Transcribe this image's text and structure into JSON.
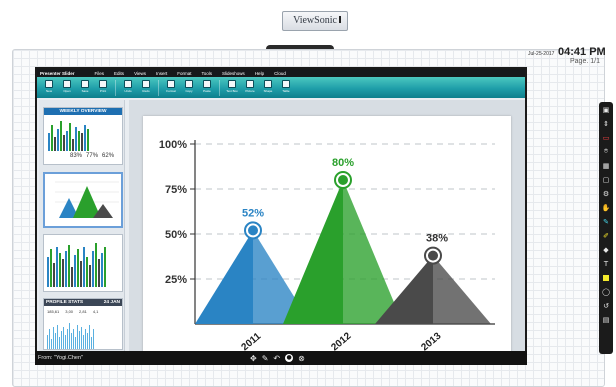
{
  "device": {
    "brand": "ViewSonic"
  },
  "status": {
    "date": "Jul-25-2017",
    "time": "04:41 PM",
    "page": "Page. 1/1"
  },
  "app": {
    "title": "Presenter Slider",
    "menu": [
      "Files",
      "Edits",
      "Views",
      "Insert",
      "Format",
      "Tools",
      "Slideshows",
      "Help",
      "Cloud"
    ],
    "ribbon_buttons": [
      {
        "label": "New",
        "icon": "new-file-icon"
      },
      {
        "label": "Open",
        "icon": "open-folder-icon"
      },
      {
        "label": "Save",
        "icon": "save-icon"
      },
      {
        "label": "Print",
        "icon": "print-icon"
      },
      {
        "label": "Undo",
        "icon": "undo-icon"
      },
      {
        "label": "Redo",
        "icon": "redo-icon"
      },
      {
        "label": "Format",
        "icon": "format-icon"
      },
      {
        "label": "Copy",
        "icon": "copy-icon"
      },
      {
        "label": "Paste",
        "icon": "paste-icon"
      },
      {
        "label": "Text Box",
        "icon": "text-box-icon"
      },
      {
        "label": "Picture",
        "icon": "picture-icon"
      },
      {
        "label": "Shape",
        "icon": "shape-icon"
      },
      {
        "label": "Table",
        "icon": "table-icon"
      }
    ]
  },
  "thumbnails": {
    "weekly_title": "WEEKLY OVERVIEW",
    "weekly_pcts": [
      "83%",
      "77%",
      "62%"
    ],
    "profile_title": "PROFILE STATS",
    "profile_tag": "24 JAN",
    "profile_values": [
      "185,61",
      "3,00",
      "2,81",
      "4,1"
    ]
  },
  "chart_data": {
    "type": "area",
    "shape": "triangle-peak",
    "categories": [
      "2011",
      "2012",
      "2013"
    ],
    "values": [
      52,
      80,
      38
    ],
    "value_labels": [
      "52%",
      "80%",
      "38%"
    ],
    "y_ticks": [
      "100%",
      "75%",
      "50%",
      "25%"
    ],
    "ylim": [
      0,
      100
    ],
    "grid": true,
    "colors": [
      "#2a84c4",
      "#2aa02c",
      "#4a4a4a"
    ]
  },
  "footer": {
    "from_label": "From: \"Yogi.Chen\"",
    "icons": [
      "move-icon",
      "pen-icon",
      "undo-icon",
      "record-icon",
      "close-icon"
    ]
  },
  "side_tools": [
    "window-icon",
    "scroll-icon",
    "record-red-icon",
    "camera-icon",
    "grid-icon",
    "folder-icon",
    "gear-icon",
    "hand-icon",
    "cyan-pen-icon",
    "highlighter-icon",
    "eraser-icon",
    "text-icon",
    "yellow-note-icon",
    "lasso-icon",
    "undo-circle-icon",
    "save-icon"
  ]
}
